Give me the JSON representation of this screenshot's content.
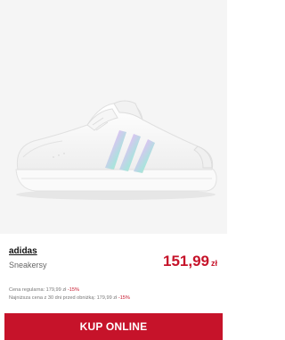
{
  "product": {
    "brand": "adidas",
    "model": "Sneakersy",
    "price_value": "151,99",
    "price_currency": "zł",
    "image_alt": "sneaker-image"
  },
  "price_notes": {
    "regular_label": "Cena regularna: 179,99 zł -15%",
    "regular_prefix": "Cena regularna: 179,99 zł ",
    "regular_discount": "-15%",
    "lowest_prefix": "Najniższa cena z 30 dni przed obniżką: 179,99 zł ",
    "lowest_discount": "-15%"
  },
  "actions": {
    "buy_label": "KUP ONLINE"
  },
  "colors": {
    "accent": "#c6132a",
    "image_bg": "#f5f5f5"
  }
}
